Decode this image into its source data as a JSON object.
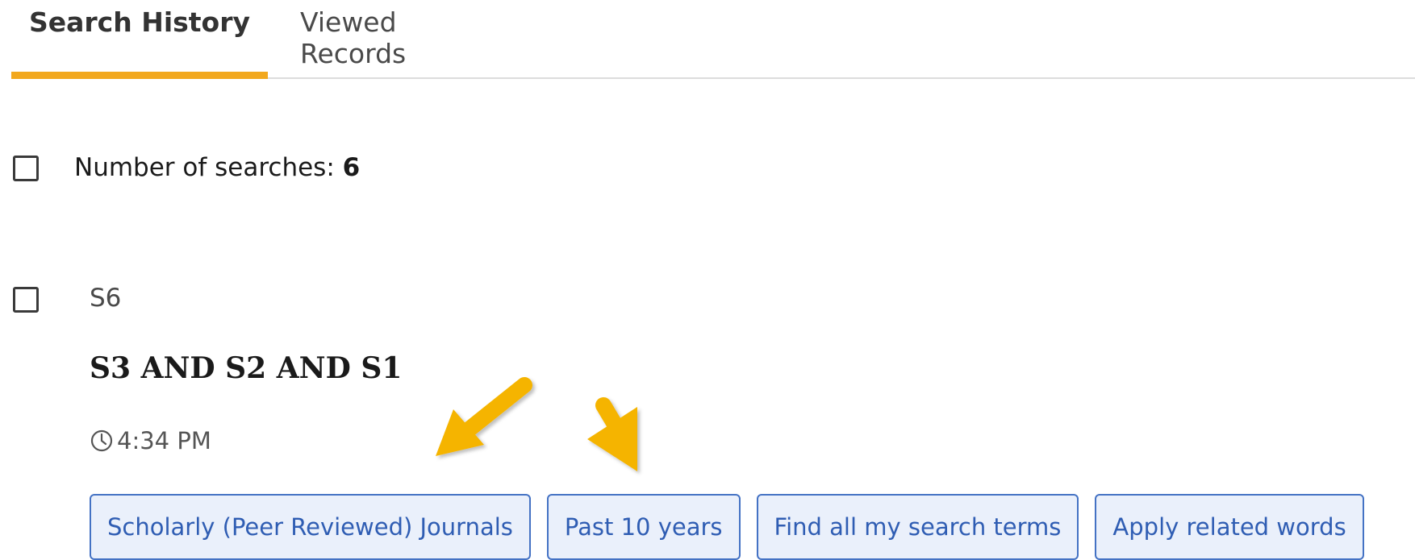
{
  "tabs": {
    "search_history": "Search History",
    "viewed_records": "Viewed Records"
  },
  "summary": {
    "label": "Number of searches:",
    "count": "6"
  },
  "search": {
    "id": "S6",
    "query": "S3 AND S2 AND S1",
    "time": "4:34 PM",
    "filters": [
      "Scholarly (Peer Reviewed) Journals",
      "Past 10 years",
      "Find all my search terms",
      "Apply related words"
    ]
  },
  "colors": {
    "tab_underline": "#f2a81d",
    "chip_border": "#4472c4",
    "chip_background": "#eaf0fb",
    "chip_text": "#2f5db3",
    "annotation_arrow": "#f5b400"
  }
}
